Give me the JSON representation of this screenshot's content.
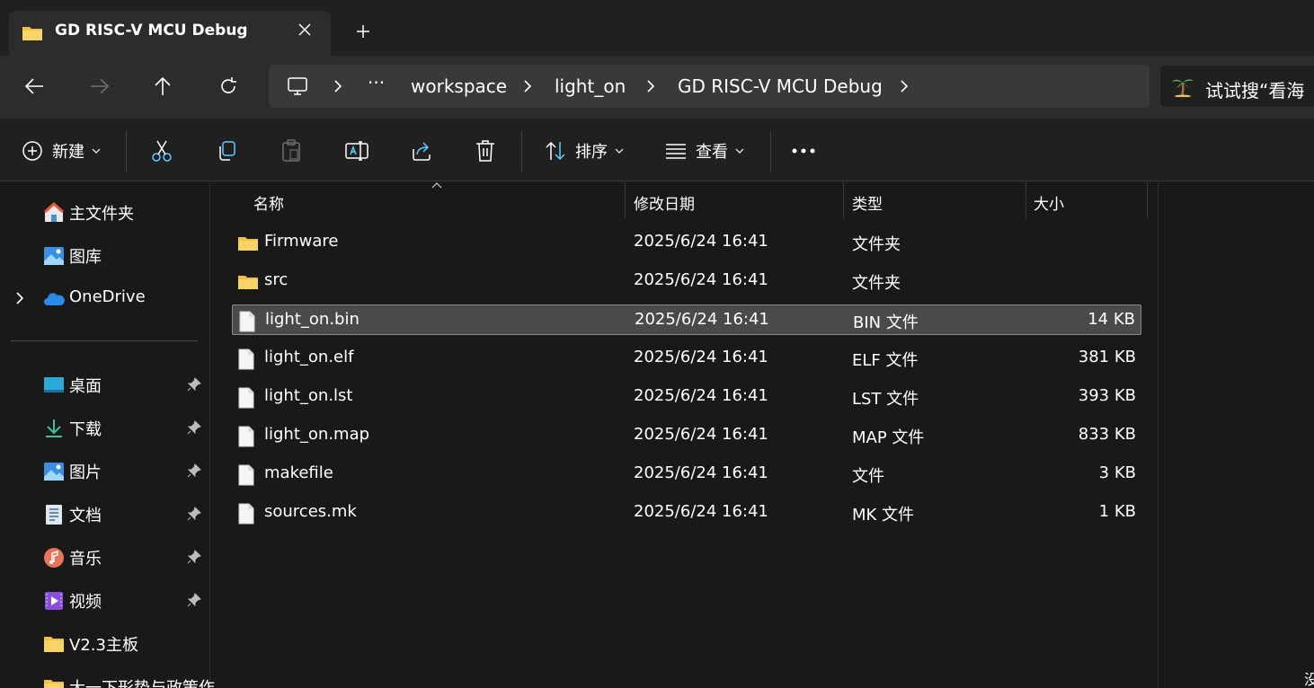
{
  "window": {
    "tab_title": "GD RISC-V MCU Debug"
  },
  "address": {
    "breadcrumbs": [
      "workspace",
      "light_on",
      "GD RISC-V MCU Debug"
    ],
    "ellipsis": "···",
    "search_placeholder": "试试搜“看海"
  },
  "toolbar": {
    "new_label": "新建",
    "sort_label": "排序",
    "view_label": "查看",
    "more_label": "···"
  },
  "sidebar": {
    "top_items": [
      {
        "label": "主文件夹",
        "icon": "home-icon"
      },
      {
        "label": "图库",
        "icon": "gallery-icon"
      },
      {
        "label": "OneDrive",
        "icon": "onedrive-icon"
      }
    ],
    "pinned_items": [
      {
        "label": "桌面",
        "icon": "desktop-icon"
      },
      {
        "label": "下载",
        "icon": "download-icon"
      },
      {
        "label": "图片",
        "icon": "pictures-icon"
      },
      {
        "label": "文档",
        "icon": "documents-icon"
      },
      {
        "label": "音乐",
        "icon": "music-icon"
      },
      {
        "label": "视频",
        "icon": "videos-icon"
      },
      {
        "label": "V2.3主板",
        "icon": "folder-icon"
      },
      {
        "label": "大一下形势与政策作",
        "icon": "folder-icon"
      }
    ]
  },
  "columns": {
    "name": "名称",
    "date": "修改日期",
    "type": "类型",
    "size": "大小"
  },
  "files": [
    {
      "name": "Firmware",
      "date": "2025/6/24 16:41",
      "type": "文件夹",
      "size": "",
      "kind": "folder"
    },
    {
      "name": "src",
      "date": "2025/6/24 16:41",
      "type": "文件夹",
      "size": "",
      "kind": "folder"
    },
    {
      "name": "light_on.bin",
      "date": "2025/6/24 16:41",
      "type": "BIN 文件",
      "size": "14 KB",
      "kind": "file"
    },
    {
      "name": "light_on.elf",
      "date": "2025/6/24 16:41",
      "type": "ELF 文件",
      "size": "381 KB",
      "kind": "file"
    },
    {
      "name": "light_on.lst",
      "date": "2025/6/24 16:41",
      "type": "LST 文件",
      "size": "393 KB",
      "kind": "file"
    },
    {
      "name": "light_on.map",
      "date": "2025/6/24 16:41",
      "type": "MAP 文件",
      "size": "833 KB",
      "kind": "file"
    },
    {
      "name": "makefile",
      "date": "2025/6/24 16:41",
      "type": "文件",
      "size": "3 KB",
      "kind": "file"
    },
    {
      "name": "sources.mk",
      "date": "2025/6/24 16:41",
      "type": "MK 文件",
      "size": "1 KB",
      "kind": "file"
    }
  ],
  "preview": {
    "text": "没"
  },
  "colors": {
    "folder": "#f0c040",
    "accent": "#60cdff",
    "selected_row": "#4a4a4a"
  }
}
